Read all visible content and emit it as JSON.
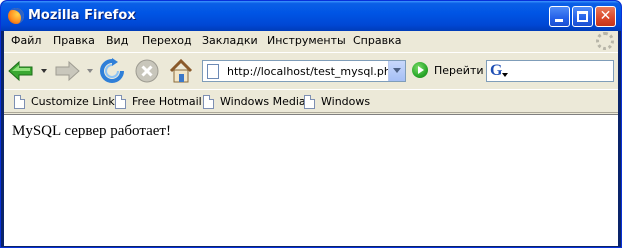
{
  "window": {
    "title": "Mozilla Firefox",
    "close_glyph": "✕"
  },
  "menubar": {
    "items": [
      {
        "label": "Файл"
      },
      {
        "label": "Правка"
      },
      {
        "label": "Вид"
      },
      {
        "label": "Переход"
      },
      {
        "label": "Закладки"
      },
      {
        "label": "Инструменты"
      },
      {
        "label": "Справка"
      }
    ]
  },
  "navbar": {
    "url": "http://localhost/test_mysql.php",
    "go_label": "Перейти",
    "search_engine_glyph": "G"
  },
  "bookmarks": {
    "items": [
      {
        "label": "Customize Links"
      },
      {
        "label": "Free Hotmail"
      },
      {
        "label": "Windows Media"
      },
      {
        "label": "Windows"
      }
    ]
  },
  "content": {
    "text": "MySQL сервер работает!"
  },
  "colors": {
    "titlebar": "#0055e5",
    "chrome": "#ece9d8",
    "back_arrow": "#3aa832"
  }
}
